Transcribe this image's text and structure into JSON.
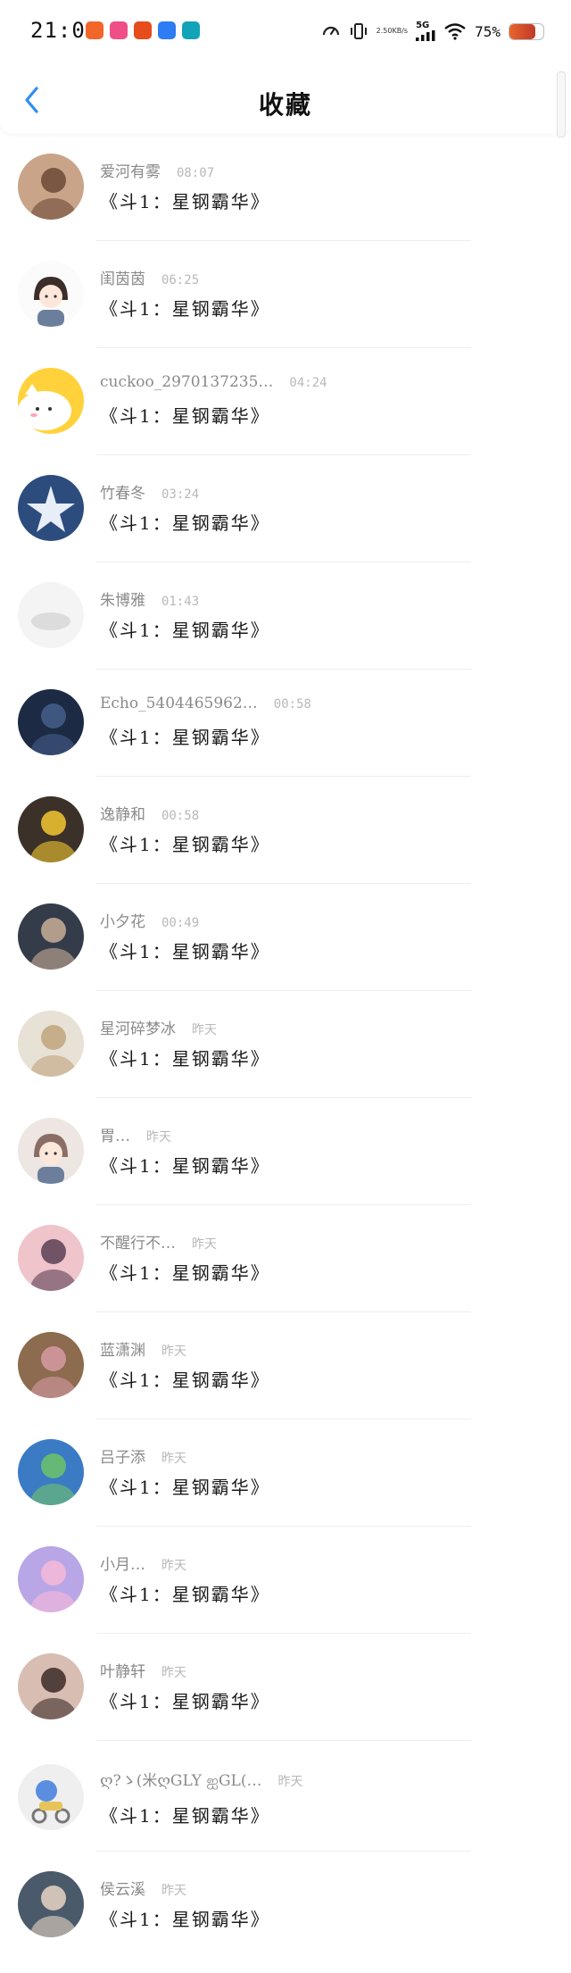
{
  "status_bar": {
    "time": "21:01",
    "network_speed_value": "2.50",
    "network_speed_unit": "KB/s",
    "network_type": "5G",
    "battery_percent": "75%",
    "battery_level": 0.75,
    "app_icons": [
      {
        "icon": "taobao-app-icon",
        "color": "#f2662a"
      },
      {
        "icon": "pink-app-icon",
        "color": "#ef4f86"
      },
      {
        "icon": "tomato-app-icon",
        "color": "#e74c1c"
      },
      {
        "icon": "blue-browser-app-icon",
        "color": "#2d7cf3"
      },
      {
        "icon": "teal-app-icon",
        "color": "#12a3b8"
      }
    ]
  },
  "header": {
    "title": "收藏",
    "back_icon": "chevron-left-icon",
    "accent_color": "#2f8ef0"
  },
  "items": [
    {
      "name": "爱河有雾",
      "time": "08:07",
      "content": "《斗1：星钢霸华》",
      "avatar": {
        "kind": "photo",
        "bg": "#c9a489",
        "accent": "#6c4a36"
      }
    },
    {
      "name": "闺茵茵",
      "time": "06:25",
      "content": "《斗1：星钢霸华》",
      "avatar": {
        "kind": "cartoon-girl",
        "bg": "#fbfbfb",
        "accent": "#3a2d2a"
      }
    },
    {
      "name": "cuckoo_2970137235…",
      "time": "04:24",
      "content": "《斗1：星钢霸华》",
      "avatar": {
        "kind": "cartoon-cat",
        "bg": "#ffd23c",
        "accent": "#ffffff"
      }
    },
    {
      "name": "竹春冬",
      "time": "03:24",
      "content": "《斗1：星钢霸华》",
      "avatar": {
        "kind": "star",
        "bg": "#2d4c7e",
        "accent": "#e7eef7"
      }
    },
    {
      "name": "朱博雅",
      "time": "01:43",
      "content": "《斗1：星钢霸华》",
      "avatar": {
        "kind": "faded",
        "bg": "#f4f4f4",
        "accent": "#dcdcdc"
      }
    },
    {
      "name": "Echo_5404465962…",
      "time": "00:58",
      "content": "《斗1：星钢霸华》",
      "avatar": {
        "kind": "photo",
        "bg": "#1c2a44",
        "accent": "#455f88"
      }
    },
    {
      "name": "逸静和",
      "time": "00:58",
      "content": "《斗1：星钢霸华》",
      "avatar": {
        "kind": "photo",
        "bg": "#3b3128",
        "accent": "#f4c731"
      }
    },
    {
      "name": "小夕花",
      "time": "00:49",
      "content": "《斗1：星钢霸华》",
      "avatar": {
        "kind": "photo",
        "bg": "#343c4a",
        "accent": "#c9ad98"
      }
    },
    {
      "name": "星河碎梦冰",
      "time": "昨天",
      "content": "《斗1：星钢霸华》",
      "avatar": {
        "kind": "photo",
        "bg": "#e8e2d6",
        "accent": "#bfa57d"
      }
    },
    {
      "name": "胃…",
      "time": "昨天",
      "content": "《斗1：星钢霸华》",
      "avatar": {
        "kind": "cartoon-girl",
        "bg": "#eee6e2",
        "accent": "#8a6e66"
      }
    },
    {
      "name": "不醒行不…",
      "time": "昨天",
      "content": "《斗1：星钢霸华》",
      "avatar": {
        "kind": "photo",
        "bg": "#efc4ca",
        "accent": "#5b3f55"
      }
    },
    {
      "name": "蓝潇渊",
      "time": "昨天",
      "content": "《斗1：星钢霸华》",
      "avatar": {
        "kind": "photo",
        "bg": "#8c6b4e",
        "accent": "#d79aa4"
      }
    },
    {
      "name": "吕子添",
      "time": "昨天",
      "content": "《斗1：星钢霸华》",
      "avatar": {
        "kind": "photo",
        "bg": "#3b7bc4",
        "accent": "#6fc36a"
      }
    },
    {
      "name": "小月…",
      "time": "昨天",
      "content": "《斗1：星钢霸华》",
      "avatar": {
        "kind": "photo",
        "bg": "#b9a6e6",
        "accent": "#f6b9d8"
      }
    },
    {
      "name": "叶静轩",
      "time": "昨天",
      "content": "《斗1：星钢霸华》",
      "avatar": {
        "kind": "photo",
        "bg": "#d7bdb2",
        "accent": "#3b2a27"
      }
    },
    {
      "name": "ღ?ゝ(米ღGLY ஐGL(…",
      "time": "昨天",
      "content": "《斗1：星钢霸华》",
      "avatar": {
        "kind": "cartoon-rider",
        "bg": "#efefef",
        "accent": "#5b8ee0"
      }
    },
    {
      "name": "侯云溪",
      "time": "昨天",
      "content": "《斗1：星钢霸华》",
      "avatar": {
        "kind": "photo",
        "bg": "#4b5a6a",
        "accent": "#e8d5c4"
      }
    }
  ]
}
